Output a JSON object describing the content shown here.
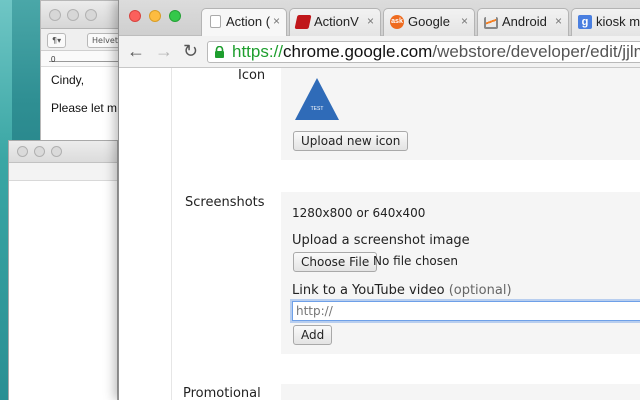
{
  "textedit": {
    "toolbar_style": "¶▾",
    "toolbar_font": "Helvet",
    "ruler_mark": "0",
    "lines": [
      "Cindy,",
      "Please let m"
    ]
  },
  "chrome": {
    "tabs": [
      {
        "label": "Action (",
        "icon": "document-icon",
        "icon_color": "#ffffff"
      },
      {
        "label": "ActionV",
        "icon": "actionview-icon",
        "icon_color": "#c0161a"
      },
      {
        "label": "Google",
        "icon": "ask-icon",
        "icon_color": "#ee6b1f"
      },
      {
        "label": "Android",
        "icon": "stackoverflow-icon",
        "icon_color": "#f48024"
      },
      {
        "label": "kiosk m",
        "icon": "google-g-icon",
        "icon_color": "#4a7fe0"
      }
    ],
    "tab_close": "×",
    "nav": {
      "back": "←",
      "forward": "→",
      "reload": "↻"
    },
    "url": {
      "scheme": "https://",
      "host": "chrome.google.com",
      "path": "/webstore/developer/edit/jjlmk"
    }
  },
  "page": {
    "icon_section": {
      "label": "Icon",
      "icon_text": "TEST",
      "upload_button": "Upload new icon"
    },
    "screenshots_section": {
      "label": "Screenshots",
      "size_hint": "1280x800 or 640x400",
      "upload_heading": "Upload a screenshot image",
      "choose_file": "Choose File",
      "no_file": "No file chosen",
      "video_heading": "Link to a YouTube video",
      "video_optional": "(optional)",
      "video_placeholder": "http://",
      "add_button": "Add"
    },
    "promotional_section": {
      "label": "Promotional"
    }
  },
  "colors": {
    "url_green": "#1e9e2e",
    "focus_blue": "#6ea0e8",
    "icon_blue": "#2f6bb8"
  }
}
